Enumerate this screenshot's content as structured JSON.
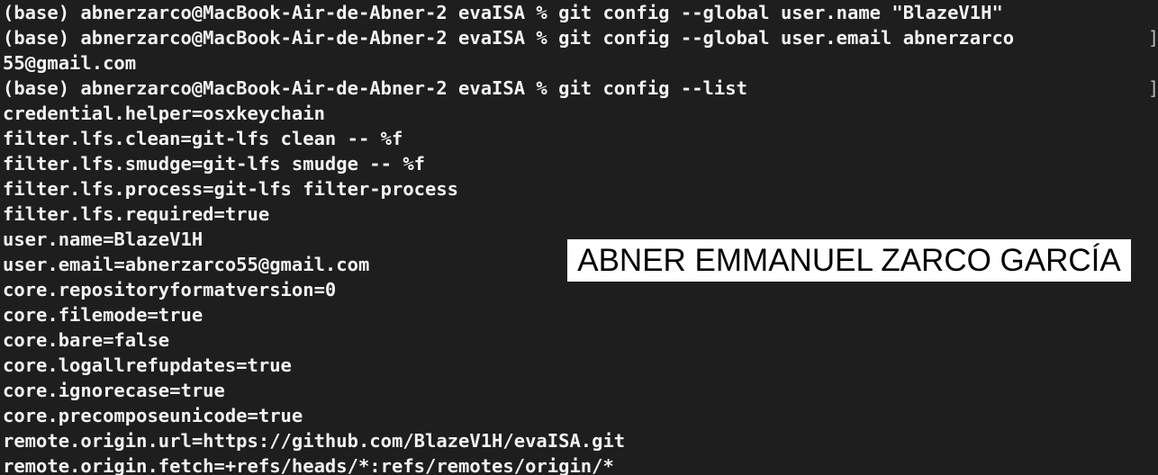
{
  "terminal": {
    "lines": [
      "(base) abnerzarco@MacBook-Air-de-Abner-2 evaISA % git config --global user.name \"BlazeV1H\"",
      "(base) abnerzarco@MacBook-Air-de-Abner-2 evaISA % git config --global user.email abnerzarco",
      "55@gmail.com",
      "(base) abnerzarco@MacBook-Air-de-Abner-2 evaISA % git config --list",
      "credential.helper=osxkeychain",
      "filter.lfs.clean=git-lfs clean -- %f",
      "filter.lfs.smudge=git-lfs smudge -- %f",
      "filter.lfs.process=git-lfs filter-process",
      "filter.lfs.required=true",
      "user.name=BlazeV1H",
      "user.email=abnerzarco55@gmail.com",
      "core.repositoryformatversion=0",
      "core.filemode=true",
      "core.bare=false",
      "core.logallrefupdates=true",
      "core.ignorecase=true",
      "core.precomposeunicode=true",
      "remote.origin.url=https://github.com/BlazeV1H/evaISA.git",
      "remote.origin.fetch=+refs/heads/*:refs/remotes/origin/*"
    ],
    "wrap_marker": "]"
  },
  "overlay": {
    "name_label": "ABNER EMMANUEL ZARCO GARCÍA"
  },
  "colors": {
    "background": "#1e1e1e",
    "text": "#f2f2f2",
    "label_background": "#ffffff",
    "label_text": "#000000"
  }
}
